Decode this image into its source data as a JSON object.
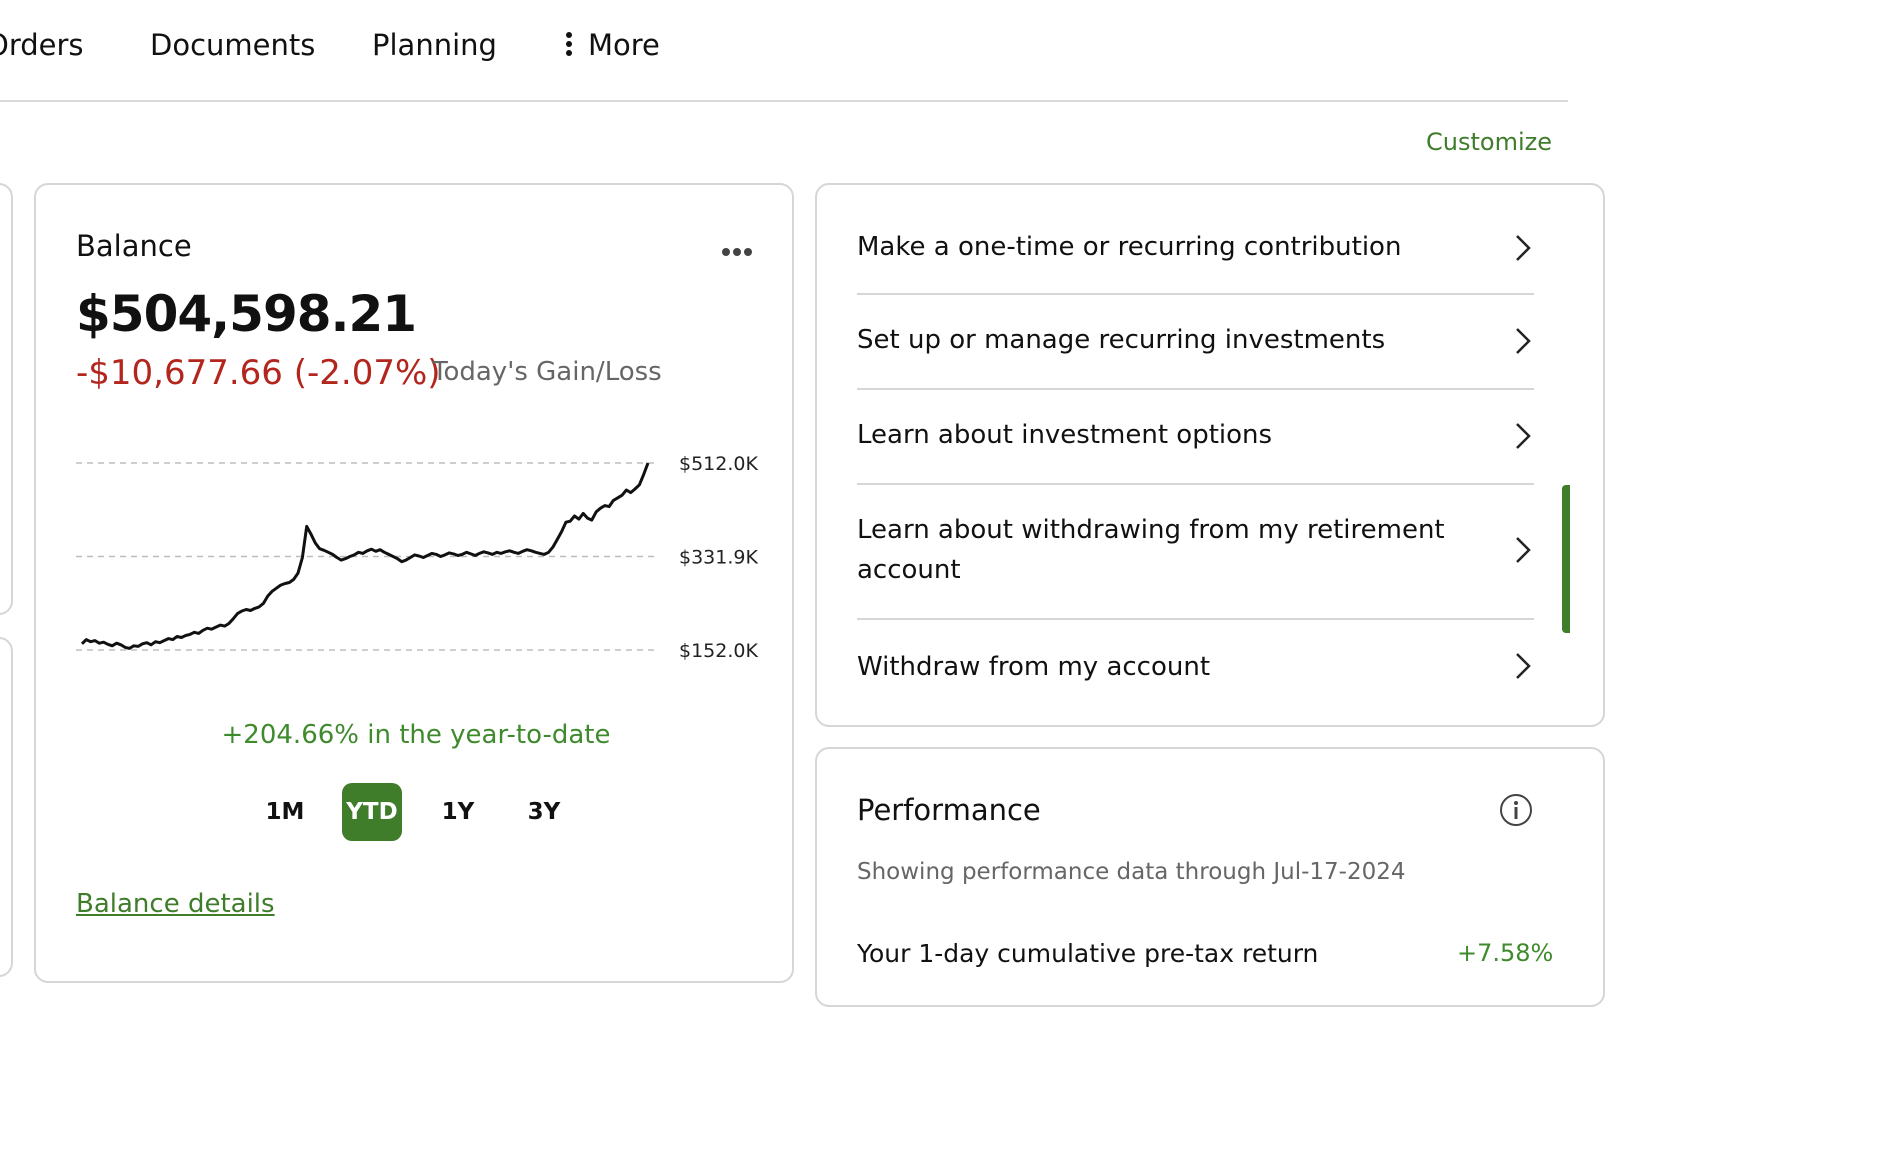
{
  "nav": {
    "items": [
      "Orders",
      "Documents",
      "Planning"
    ],
    "more_label": "More"
  },
  "customize_label": "Customize",
  "balance": {
    "title": "Balance",
    "amount": "$504,598.21",
    "change": "-$10,677.66 (-2.07%)",
    "change_label": "Today's Gain/Loss",
    "ytd_summary": "+204.66% in the year-to-date",
    "ranges": [
      "1M",
      "YTD",
      "1Y",
      "3Y"
    ],
    "active_range": "YTD",
    "details_link": "Balance details"
  },
  "chart_data": {
    "type": "line",
    "title": "",
    "xlabel": "",
    "ylabel": "",
    "y_ticks": [
      "$512.0K",
      "$331.9K",
      "$152.0K"
    ],
    "y_tick_values": [
      512.0,
      331.9,
      152.0
    ],
    "ylim": [
      152.0,
      512.0
    ],
    "grid": "dashed horizontal",
    "series": [
      {
        "values": [
          164,
          172,
          168,
          170,
          165,
          167,
          163,
          160,
          165,
          162,
          157,
          155,
          160,
          159,
          164,
          166,
          162,
          168,
          166,
          170,
          174,
          172,
          178,
          176,
          180,
          182,
          186,
          184,
          190,
          194,
          192,
          196,
          200,
          198,
          203,
          212,
          222,
          227,
          230,
          228,
          232,
          235,
          242,
          256,
          265,
          271,
          277,
          280,
          282,
          288,
          300,
          330,
          390,
          375,
          358,
          347,
          344,
          340,
          336,
          330,
          325,
          328,
          332,
          335,
          340,
          338,
          343,
          346,
          342,
          345,
          340,
          336,
          332,
          328,
          322,
          325,
          330,
          335,
          333,
          330,
          334,
          338,
          336,
          332,
          335,
          339,
          337,
          334,
          336,
          340,
          337,
          334,
          338,
          341,
          339,
          336,
          340,
          338,
          341,
          343,
          340,
          338,
          342,
          345,
          343,
          340,
          338,
          336,
          340,
          350,
          365,
          380,
          398,
          400,
          410,
          404,
          415,
          406,
          402,
          418,
          425,
          430,
          428,
          440,
          445,
          450,
          460,
          455,
          462,
          470,
          490,
          512
        ]
      }
    ],
    "series_color": "#111111"
  },
  "actions": {
    "items": [
      "Make a one-time or recurring contribution",
      "Set up or manage recurring investments",
      "Learn about investment options",
      "Learn about withdrawing from my retirement account",
      "Withdraw from my account"
    ]
  },
  "performance": {
    "title": "Performance",
    "subtitle": "Showing performance data through Jul-17-2024",
    "row_label": "Your 1-day cumulative pre-tax return",
    "row_value": "+7.58%"
  },
  "colors": {
    "accent_green": "#3f7d2b",
    "gain_green": "#3f8a2d",
    "loss_red": "#b3261e",
    "border": "#d6d6d6"
  }
}
